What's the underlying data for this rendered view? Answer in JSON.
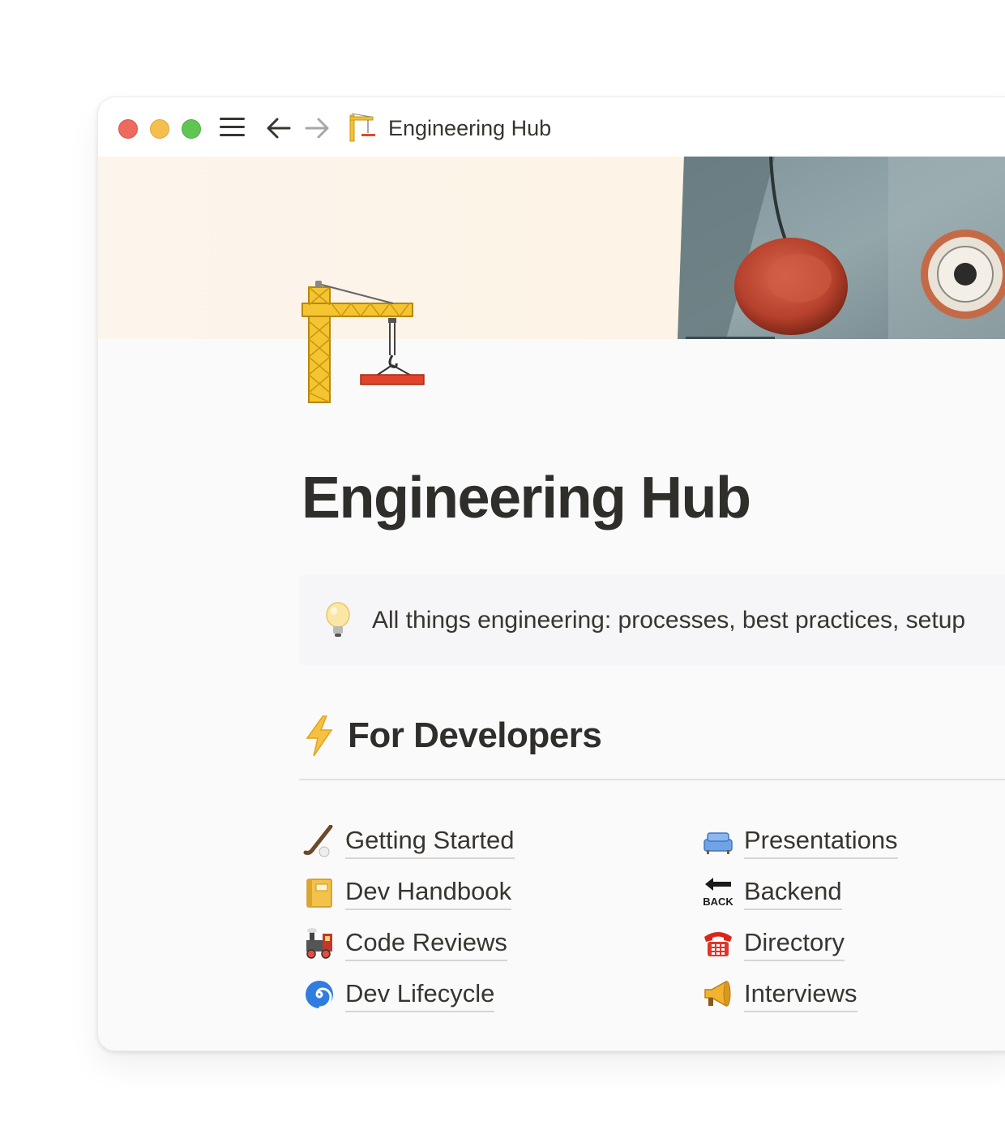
{
  "window": {
    "title": "Engineering Hub",
    "traffic_light_colors": [
      "#ed6a5e",
      "#f5bf4f",
      "#61c554"
    ]
  },
  "page": {
    "title": "Engineering Hub",
    "icon": "construction-crane"
  },
  "callout": {
    "icon": "light-bulb",
    "text": "All things engineering: processes, best practices, setup"
  },
  "section": {
    "icon": "high-voltage",
    "title": "For Developers"
  },
  "links": {
    "left": [
      {
        "icon": "field-hockey",
        "label": "Getting Started"
      },
      {
        "icon": "ledger",
        "label": "Dev Handbook"
      },
      {
        "icon": "locomotive",
        "label": "Code Reviews"
      },
      {
        "icon": "cyclone",
        "label": "Dev Lifecycle"
      }
    ],
    "right": [
      {
        "icon": "couch",
        "label": "Presentations"
      },
      {
        "icon": "back-arrow",
        "label": "Backend",
        "icon_caption": "BACK"
      },
      {
        "icon": "telephone",
        "label": "Directory"
      },
      {
        "icon": "megaphone",
        "label": "Interviews"
      }
    ]
  }
}
